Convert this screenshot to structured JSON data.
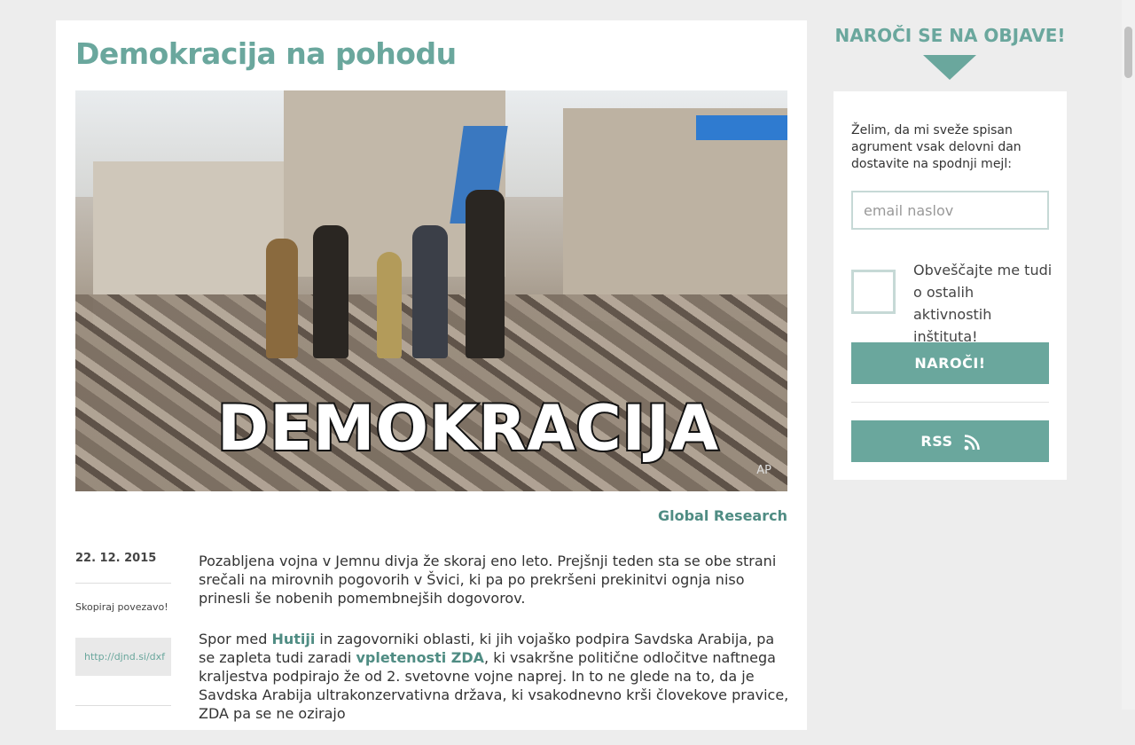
{
  "article": {
    "title": "Demokracija na pohodu",
    "image_caption": "DEMOKRACIJA",
    "image_credit": "AP",
    "source": "Global Research",
    "date": "22. 12. 2015",
    "copy_label": "Skopiraj povezavo!",
    "short_link": "http://djnd.si/dxf",
    "paragraphs": {
      "p1": "Pozabljena vojna v Jemnu divja že skoraj eno leto. Prejšnji teden sta se obe strani srečali na mirovnih pogovorih v Švici, ki pa po prekršeni prekinitvi ognja niso prinesli še nobenih pomembnejših dogovorov.",
      "p2_a": "Spor med ",
      "p2_link1": "Hutiji",
      "p2_b": " in zagovorniki oblasti, ki jih vojaško podpira Savdska Arabija, pa se zapleta tudi zaradi ",
      "p2_link2": "vpletenosti ZDA",
      "p2_c": ", ki vsakršne politične odločitve naftnega kraljestva podpirajo že od 2. svetovne vojne naprej. In to ne glede na to, da je Savdska Arabija ultrakonzervativna država, ki vsakodnevno krši človekove pravice, ZDA pa se ne ozirajo"
    }
  },
  "sidebar": {
    "heading": "NAROČI SE NA OBJAVE!",
    "intro": "Želim, da mi sveže spisan agrument vsak delovni dan dostavite na spodnji mejl:",
    "email_placeholder": "email naslov",
    "checkbox_label": "Obveščajte me tudi o ostalih aktivnostih inštituta!",
    "subscribe_label": "NAROČI!",
    "rss_label": "RSS"
  },
  "colors": {
    "accent": "#6aa79d",
    "link": "#4f8c83",
    "background": "#ededed"
  }
}
